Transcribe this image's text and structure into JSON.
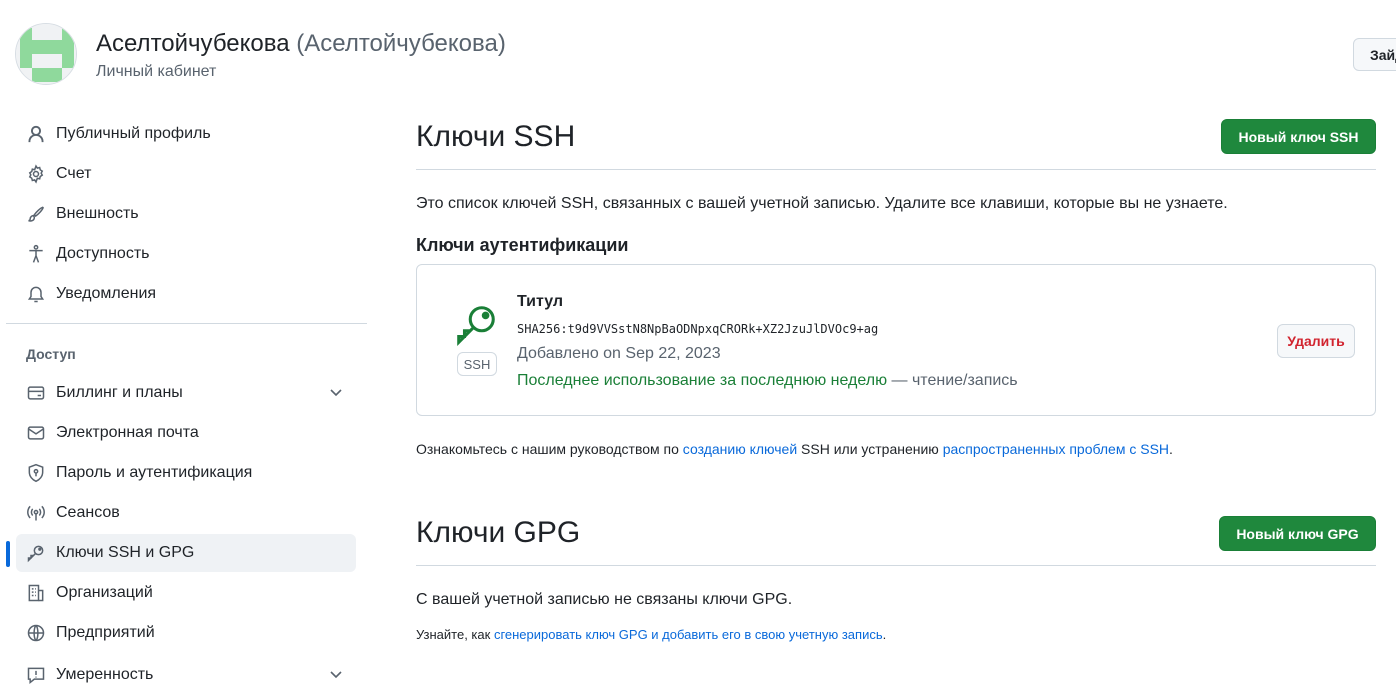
{
  "header": {
    "display_name": "Аселтойчубекова",
    "login": "(Аселтойчубекова)",
    "subtitle": "Личный кабинет",
    "goto_profile_label": "Зайд"
  },
  "sidebar": {
    "items_top": [
      {
        "label": "Публичный профиль",
        "icon": "person-icon"
      },
      {
        "label": "Счет",
        "icon": "gear-icon"
      },
      {
        "label": "Внешность",
        "icon": "paintbrush-icon"
      },
      {
        "label": "Доступность",
        "icon": "accessibility-icon"
      },
      {
        "label": "Уведомления",
        "icon": "bell-icon"
      }
    ],
    "section_heading": "Доступ",
    "items_access": [
      {
        "label": "Биллинг и планы",
        "icon": "credit-card-icon",
        "expandable": true
      },
      {
        "label": "Электронная почта",
        "icon": "mail-icon"
      },
      {
        "label": "Пароль и аутентификация",
        "icon": "shield-lock-icon"
      },
      {
        "label": "Сеансов",
        "icon": "broadcast-icon"
      },
      {
        "label": "Ключи SSH и GPG",
        "icon": "key-icon",
        "active": true
      },
      {
        "label": "Организаций",
        "icon": "organization-icon"
      },
      {
        "label": "Предприятий",
        "icon": "globe-icon"
      },
      {
        "label": "Умеренность",
        "icon": "report-icon",
        "expandable": true
      }
    ]
  },
  "ssh": {
    "title": "Ключи SSH",
    "new_button": "Новый ключ SSH",
    "description": "Это список ключей SSH, связанных с вашей учетной записью. Удалите все клавиши, которые вы не узнаете.",
    "auth_heading": "Ключи аутентификации",
    "key": {
      "type_label": "SSH",
      "title": "Титул",
      "fingerprint": "SHA256:t9d9VVSstN8NpBaODNpxqCRORk+XZ2JzuJlDVOc9+ag",
      "added": "Добавлено on Sep 22, 2023",
      "last_used": "Последнее использование за последнюю неделю",
      "access": " — чтение/запись",
      "delete_label": "Удалить"
    },
    "guide": {
      "prefix": "Ознакомьтесь с нашим руководством по ",
      "link1": "созданию ключей",
      "middle": " SSH или устранению ",
      "link2": "распространенных проблем с SSH",
      "suffix": "."
    }
  },
  "gpg": {
    "title": "Ключи GPG",
    "new_button": "Новый ключ GPG",
    "empty": "С вашей учетной записью не связаны ключи GPG.",
    "learn": {
      "prefix": "Узнайте, как ",
      "link": "сгенерировать ключ GPG и добавить его в свою учетную запись",
      "suffix": "."
    }
  },
  "colors": {
    "primary_green": "#1f883d",
    "success_text": "#1a7f37",
    "danger_text": "#d1242f",
    "link": "#0969da",
    "active_indicator": "#0969da",
    "avatar_green": "#8fd99c"
  }
}
